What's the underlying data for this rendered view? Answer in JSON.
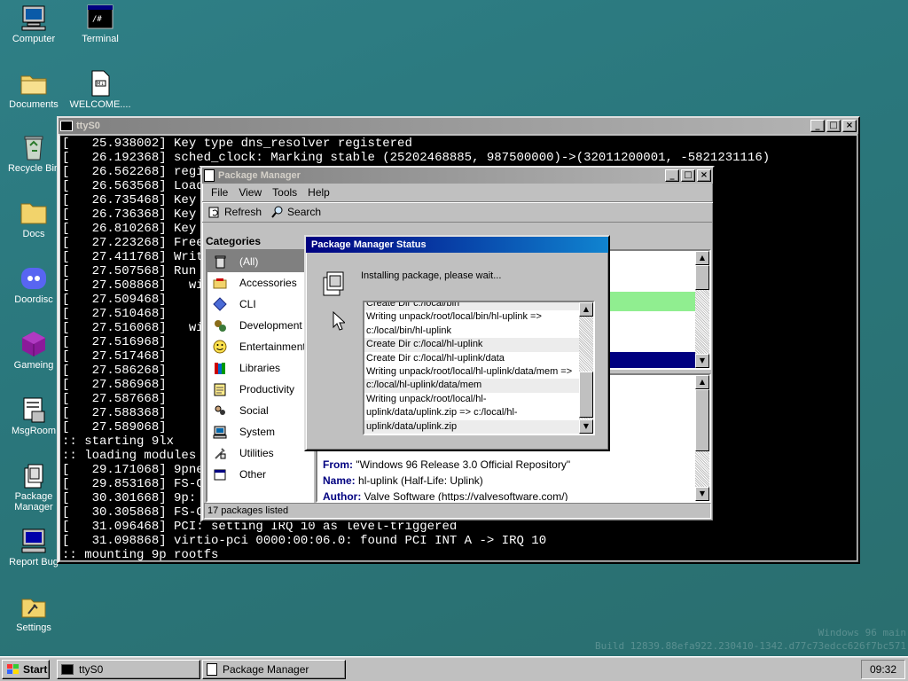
{
  "desktop": {
    "icons": [
      {
        "label": "Computer"
      },
      {
        "label": "Terminal"
      },
      {
        "label": "Documents"
      },
      {
        "label": "WELCOME...."
      },
      {
        "label": "Recycle Bin"
      },
      {
        "label": "Docs"
      },
      {
        "label": "Doordisc"
      },
      {
        "label": "Gameing"
      },
      {
        "label": "MsgRoom"
      },
      {
        "label": "Package Manager"
      },
      {
        "label": "Report Bug"
      },
      {
        "label": "Settings"
      }
    ],
    "watermark_line1": "Windows 96 main",
    "watermark_line2": "Build 12839.88efa922.230410-1342.d77c73edcc626f7bc571"
  },
  "terminal": {
    "title": "ttyS0",
    "lines": [
      "[   25.938002] Key type dns_resolver registered",
      "[   26.192368] sched_clock: Marking stable (25202468885, 987500000)->(32011200001, -5821231116)",
      "[   26.562268] regis",
      "[   26.563568] Loadi",
      "[   26.735468] Key t",
      "[   26.736368] Key t",
      "[   26.810268] Key t",
      "[   27.223268] Freei",
      "[   27.411768] Write",
      "[   27.507568] Run /",
      "[   27.508868]   wit",
      "[   27.509468]     /",
      "[   27.510468]     n",
      "[   27.516068]   wit",
      "[   27.516968]     H",
      "[   27.517468]     T",
      "[   27.586268]     a",
      "[   27.586968]     e",
      "[   27.587668]     p",
      "[   27.588368]     m",
      "[   27.589068]     b",
      ":: starting 9lx",
      ":: loading modules",
      "[   29.171068] 9pnet",
      "[   29.853168] FS-Ca",
      "[   30.301668] 9p: I",
      "[   30.305868] FS-Ca",
      "[   31.096468] PCI: setting IRQ 10 as level-triggered",
      "[   31.098868] virtio-pci 0000:00:06.0: found PCI INT A -> IRQ 10",
      ":: mounting 9p rootfs"
    ]
  },
  "package_manager": {
    "title": "Package Manager",
    "menu": [
      "File",
      "View",
      "Tools",
      "Help"
    ],
    "toolbar": {
      "refresh": "Refresh",
      "search": "Search"
    },
    "categories_heading": "Categories",
    "categories": [
      {
        "label": "(All)",
        "icon": "bin-icon",
        "selected": true
      },
      {
        "label": "Accessories",
        "icon": "accessories-icon"
      },
      {
        "label": "CLI",
        "icon": "diamond-icon"
      },
      {
        "label": "Development",
        "icon": "gears-icon"
      },
      {
        "label": "Entertainment",
        "icon": "smiley-icon"
      },
      {
        "label": "Libraries",
        "icon": "books-icon"
      },
      {
        "label": "Productivity",
        "icon": "notepad-icon"
      },
      {
        "label": "Social",
        "icon": "social-icon"
      },
      {
        "label": "System",
        "icon": "computer-icon"
      },
      {
        "label": "Utilities",
        "icon": "tools-icon"
      },
      {
        "label": "Other",
        "icon": "window-icon"
      }
    ],
    "details": {
      "from_label": "From:",
      "from_value": "\"Windows 96 Release 3.0 Official Repository\"",
      "name_label": "Name:",
      "name_value": "hl-uplink (Half-Life: Uplink)",
      "author_label": "Author:",
      "author_value": "Valve Software (https://valvesoftware.com/)"
    },
    "status_bar": "17 packages listed"
  },
  "status_dialog": {
    "title": "Package Manager Status",
    "message": "Installing package, please wait...",
    "log": [
      "Create Dir c:/local/bin",
      "Writing unpack/root/local/bin/hl-uplink =>",
      "c:/local/bin/hl-uplink",
      "Create Dir c:/local/hl-uplink",
      "Create Dir c:/local/hl-uplink/data",
      "Writing unpack/root/local/hl-uplink/data/mem =>",
      "c:/local/hl-uplink/data/mem",
      "Writing unpack/root/local/hl-",
      "uplink/data/uplink.zip => c:/local/hl-",
      "uplink/data/uplink.zip"
    ]
  },
  "taskbar": {
    "start": "Start",
    "items": [
      "ttyS0",
      "Package Manager"
    ],
    "clock": "09:32"
  },
  "colors": {
    "accent": "#000080",
    "desktop": "#2a777c"
  }
}
